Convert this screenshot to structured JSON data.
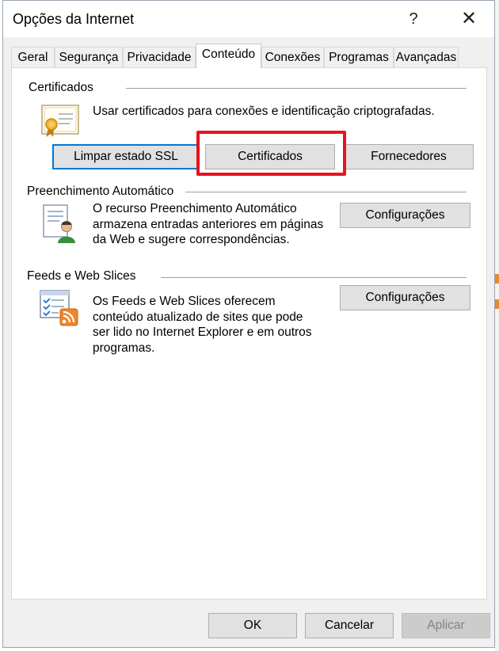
{
  "window": {
    "title": "Opções da Internet",
    "help_label": "?",
    "close_label": "✕"
  },
  "tabs": [
    {
      "label": "Geral"
    },
    {
      "label": "Segurança"
    },
    {
      "label": "Privacidade"
    },
    {
      "label": "Conteúdo",
      "active": true
    },
    {
      "label": "Conexões"
    },
    {
      "label": "Programas"
    },
    {
      "label": "Avançadas"
    }
  ],
  "certificates": {
    "group_label": "Certificados",
    "description": "Usar certificados para conexões e identificação criptografadas.",
    "icon": "certificate-icon",
    "buttons": {
      "clear_ssl": "Limpar estado SSL",
      "certificates": "Certificados",
      "publishers": "Fornecedores"
    }
  },
  "autocomplete": {
    "group_label": "Preenchimento Automático",
    "description": "O recurso Preenchimento Automático armazena entradas anteriores em páginas da Web e sugere correspondências.",
    "icon": "autocomplete-user-icon",
    "settings_label": "Configurações"
  },
  "feeds": {
    "group_label": "Feeds e Web Slices",
    "description": "Os Feeds e Web Slices oferecem conteúdo atualizado de sites que pode ser lido no Internet Explorer e em outros programas.",
    "icon": "rss-feed-icon",
    "settings_label": "Configurações"
  },
  "footer": {
    "ok_label": "OK",
    "cancel_label": "Cancelar",
    "apply_label": "Aplicar"
  },
  "colors": {
    "highlight": "#e8131c",
    "focus_border": "#0078d7"
  }
}
